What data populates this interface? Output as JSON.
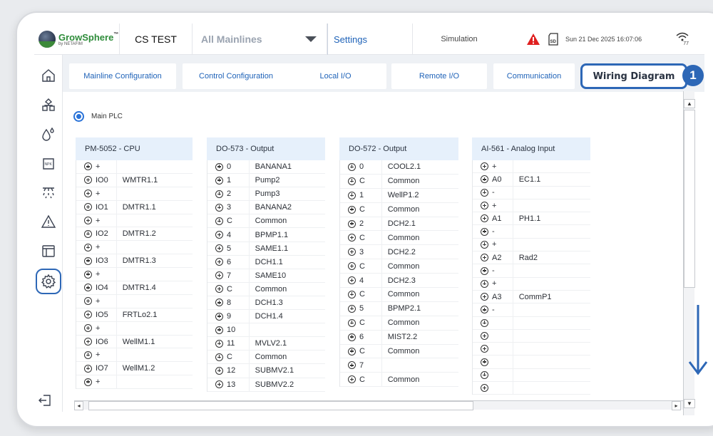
{
  "topbar": {
    "brand": "GrowSphere",
    "brand_tm": "™",
    "brand_sub": "by NETAFIM",
    "site": "CS TEST",
    "mainline": "All Mainlines",
    "settings": "Settings",
    "simulation": "Simulation",
    "datetime": "Sun 21 Dec 2025  16:07:06",
    "wifi_value": "77"
  },
  "sidebar": [
    "home-icon",
    "plant-structure-icon",
    "water-drop-icon",
    "fertilizer-icon",
    "irrigation-icon",
    "alarm-icon",
    "layout-icon",
    "settings-gear-icon"
  ],
  "tabs": [
    "Mainline Configuration",
    "Control Configuration",
    "Local I/O",
    "Remote  I/O",
    "Communication",
    "Wiring Diagram"
  ],
  "badge": "1",
  "plc_label": "Main PLC",
  "modules": [
    {
      "title": "PM-5052 - CPU",
      "rows": [
        [
          "+",
          ""
        ],
        [
          "IO0",
          "WMTR1.1"
        ],
        [
          "+",
          ""
        ],
        [
          "IO1",
          "DMTR1.1"
        ],
        [
          "+",
          ""
        ],
        [
          "IO2",
          "DMTR1.2"
        ],
        [
          "+",
          ""
        ],
        [
          "IO3",
          "DMTR1.3"
        ],
        [
          "+",
          ""
        ],
        [
          "IO4",
          "DMTR1.4"
        ],
        [
          "+",
          ""
        ],
        [
          "IO5",
          "FRTLo2.1"
        ],
        [
          "+",
          ""
        ],
        [
          "IO6",
          "WellM1.1"
        ],
        [
          "+",
          ""
        ],
        [
          "IO7",
          "WellM1.2"
        ],
        [
          "+",
          ""
        ]
      ]
    },
    {
      "title": "DO-573 - Output",
      "rows": [
        [
          "0",
          "BANANA1"
        ],
        [
          "1",
          "Pump2"
        ],
        [
          "2",
          "Pump3"
        ],
        [
          "3",
          "BANANA2"
        ],
        [
          "C",
          "Common"
        ],
        [
          "4",
          "BPMP1.1"
        ],
        [
          "5",
          "SAME1.1"
        ],
        [
          "6",
          "DCH1.1"
        ],
        [
          "7",
          "SAME10"
        ],
        [
          "C",
          "Common"
        ],
        [
          "8",
          "DCH1.3"
        ],
        [
          "9",
          "DCH1.4"
        ],
        [
          "10",
          ""
        ],
        [
          "11",
          "MVLV2.1"
        ],
        [
          "C",
          "Common"
        ],
        [
          "12",
          "SUBMV2.1"
        ],
        [
          "13",
          "SUBMV2.2"
        ]
      ]
    },
    {
      "title": "DO-572 - Output",
      "rows": [
        [
          "0",
          "COOL2.1"
        ],
        [
          "C",
          "Common"
        ],
        [
          "1",
          "WellP1.2"
        ],
        [
          "C",
          "Common"
        ],
        [
          "2",
          "DCH2.1"
        ],
        [
          "C",
          "Common"
        ],
        [
          "3",
          "DCH2.2"
        ],
        [
          "C",
          "Common"
        ],
        [
          "4",
          "DCH2.3"
        ],
        [
          "C",
          "Common"
        ],
        [
          "5",
          "BPMP2.1"
        ],
        [
          "C",
          "Common"
        ],
        [
          "6",
          "MIST2.2"
        ],
        [
          "C",
          "Common"
        ],
        [
          "7",
          ""
        ],
        [
          "C",
          "Common"
        ]
      ]
    },
    {
      "title": "AI-561 - Analog Input",
      "rows": [
        [
          "+",
          ""
        ],
        [
          "A0",
          "EC1.1"
        ],
        [
          "-",
          ""
        ],
        [
          "+",
          ""
        ],
        [
          "A1",
          "PH1.1"
        ],
        [
          "-",
          ""
        ],
        [
          "+",
          ""
        ],
        [
          "A2",
          "Rad2"
        ],
        [
          "-",
          ""
        ],
        [
          "+",
          ""
        ],
        [
          "A3",
          "CommP1"
        ],
        [
          "-",
          ""
        ],
        [
          "",
          ""
        ],
        [
          "",
          ""
        ],
        [
          "",
          ""
        ],
        [
          "",
          ""
        ],
        [
          "",
          ""
        ],
        [
          "",
          ""
        ]
      ]
    }
  ],
  "colors": {
    "accent": "#2d67b6",
    "alert": "#e02020",
    "brand_green": "#2e8c3a",
    "header_bg": "#e6f0fb"
  }
}
